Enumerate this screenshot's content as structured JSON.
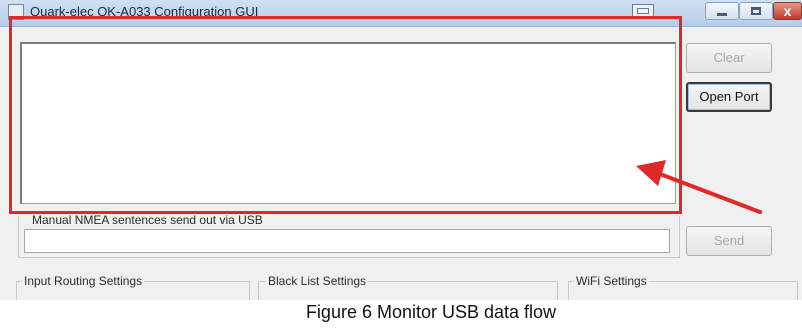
{
  "window": {
    "title": "Quark-elec QK-A033 Configuration GUI",
    "close_glyph": "x"
  },
  "buttons": {
    "clear": "Clear",
    "open_port": "Open Port",
    "send": "Send"
  },
  "manual": {
    "label": "Manual NMEA sentences send out via USB",
    "value": ""
  },
  "groups": {
    "input_routing": "Input Routing Settings",
    "black_list": "Black List Settings",
    "wifi": "WiFi Settings"
  },
  "caption": "Figure 6 Monitor USB data flow",
  "colors": {
    "highlight": "#e12828",
    "window_bg": "#f0f0f0"
  },
  "icons": [
    "app-icon",
    "keyboard-icon",
    "minimize-icon",
    "maximize-icon",
    "close-icon",
    "arrow-pointer-icon"
  ]
}
